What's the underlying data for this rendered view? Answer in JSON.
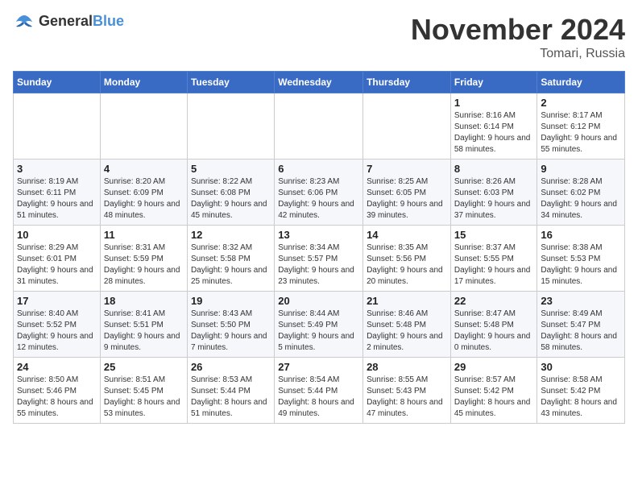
{
  "logo": {
    "general": "General",
    "blue": "Blue"
  },
  "title": "November 2024",
  "location": "Tomari, Russia",
  "days_of_week": [
    "Sunday",
    "Monday",
    "Tuesday",
    "Wednesday",
    "Thursday",
    "Friday",
    "Saturday"
  ],
  "weeks": [
    [
      {
        "day": "",
        "info": ""
      },
      {
        "day": "",
        "info": ""
      },
      {
        "day": "",
        "info": ""
      },
      {
        "day": "",
        "info": ""
      },
      {
        "day": "",
        "info": ""
      },
      {
        "day": "1",
        "info": "Sunrise: 8:16 AM\nSunset: 6:14 PM\nDaylight: 9 hours and 58 minutes."
      },
      {
        "day": "2",
        "info": "Sunrise: 8:17 AM\nSunset: 6:12 PM\nDaylight: 9 hours and 55 minutes."
      }
    ],
    [
      {
        "day": "3",
        "info": "Sunrise: 8:19 AM\nSunset: 6:11 PM\nDaylight: 9 hours and 51 minutes."
      },
      {
        "day": "4",
        "info": "Sunrise: 8:20 AM\nSunset: 6:09 PM\nDaylight: 9 hours and 48 minutes."
      },
      {
        "day": "5",
        "info": "Sunrise: 8:22 AM\nSunset: 6:08 PM\nDaylight: 9 hours and 45 minutes."
      },
      {
        "day": "6",
        "info": "Sunrise: 8:23 AM\nSunset: 6:06 PM\nDaylight: 9 hours and 42 minutes."
      },
      {
        "day": "7",
        "info": "Sunrise: 8:25 AM\nSunset: 6:05 PM\nDaylight: 9 hours and 39 minutes."
      },
      {
        "day": "8",
        "info": "Sunrise: 8:26 AM\nSunset: 6:03 PM\nDaylight: 9 hours and 37 minutes."
      },
      {
        "day": "9",
        "info": "Sunrise: 8:28 AM\nSunset: 6:02 PM\nDaylight: 9 hours and 34 minutes."
      }
    ],
    [
      {
        "day": "10",
        "info": "Sunrise: 8:29 AM\nSunset: 6:01 PM\nDaylight: 9 hours and 31 minutes."
      },
      {
        "day": "11",
        "info": "Sunrise: 8:31 AM\nSunset: 5:59 PM\nDaylight: 9 hours and 28 minutes."
      },
      {
        "day": "12",
        "info": "Sunrise: 8:32 AM\nSunset: 5:58 PM\nDaylight: 9 hours and 25 minutes."
      },
      {
        "day": "13",
        "info": "Sunrise: 8:34 AM\nSunset: 5:57 PM\nDaylight: 9 hours and 23 minutes."
      },
      {
        "day": "14",
        "info": "Sunrise: 8:35 AM\nSunset: 5:56 PM\nDaylight: 9 hours and 20 minutes."
      },
      {
        "day": "15",
        "info": "Sunrise: 8:37 AM\nSunset: 5:55 PM\nDaylight: 9 hours and 17 minutes."
      },
      {
        "day": "16",
        "info": "Sunrise: 8:38 AM\nSunset: 5:53 PM\nDaylight: 9 hours and 15 minutes."
      }
    ],
    [
      {
        "day": "17",
        "info": "Sunrise: 8:40 AM\nSunset: 5:52 PM\nDaylight: 9 hours and 12 minutes."
      },
      {
        "day": "18",
        "info": "Sunrise: 8:41 AM\nSunset: 5:51 PM\nDaylight: 9 hours and 9 minutes."
      },
      {
        "day": "19",
        "info": "Sunrise: 8:43 AM\nSunset: 5:50 PM\nDaylight: 9 hours and 7 minutes."
      },
      {
        "day": "20",
        "info": "Sunrise: 8:44 AM\nSunset: 5:49 PM\nDaylight: 9 hours and 5 minutes."
      },
      {
        "day": "21",
        "info": "Sunrise: 8:46 AM\nSunset: 5:48 PM\nDaylight: 9 hours and 2 minutes."
      },
      {
        "day": "22",
        "info": "Sunrise: 8:47 AM\nSunset: 5:48 PM\nDaylight: 9 hours and 0 minutes."
      },
      {
        "day": "23",
        "info": "Sunrise: 8:49 AM\nSunset: 5:47 PM\nDaylight: 8 hours and 58 minutes."
      }
    ],
    [
      {
        "day": "24",
        "info": "Sunrise: 8:50 AM\nSunset: 5:46 PM\nDaylight: 8 hours and 55 minutes."
      },
      {
        "day": "25",
        "info": "Sunrise: 8:51 AM\nSunset: 5:45 PM\nDaylight: 8 hours and 53 minutes."
      },
      {
        "day": "26",
        "info": "Sunrise: 8:53 AM\nSunset: 5:44 PM\nDaylight: 8 hours and 51 minutes."
      },
      {
        "day": "27",
        "info": "Sunrise: 8:54 AM\nSunset: 5:44 PM\nDaylight: 8 hours and 49 minutes."
      },
      {
        "day": "28",
        "info": "Sunrise: 8:55 AM\nSunset: 5:43 PM\nDaylight: 8 hours and 47 minutes."
      },
      {
        "day": "29",
        "info": "Sunrise: 8:57 AM\nSunset: 5:42 PM\nDaylight: 8 hours and 45 minutes."
      },
      {
        "day": "30",
        "info": "Sunrise: 8:58 AM\nSunset: 5:42 PM\nDaylight: 8 hours and 43 minutes."
      }
    ]
  ]
}
